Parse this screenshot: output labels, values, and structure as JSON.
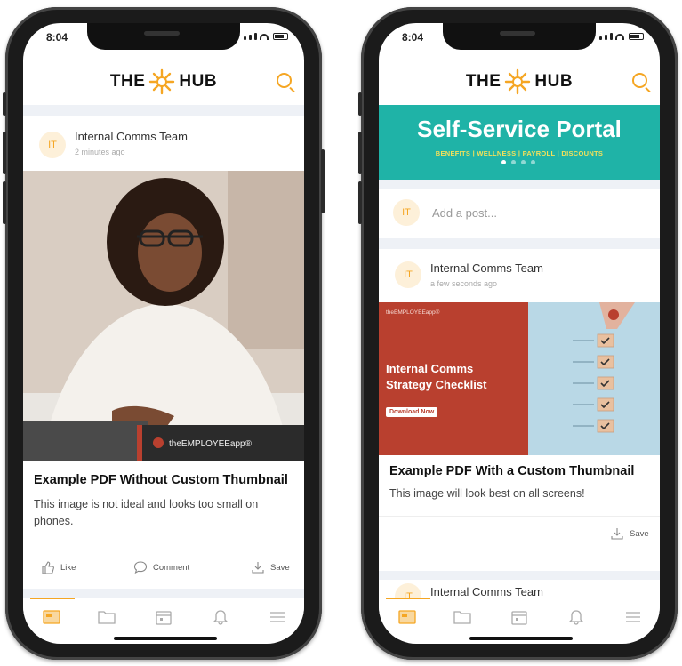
{
  "left_phone": {
    "time": "8:04",
    "app_title_left": "THE",
    "app_title_right": "HUB",
    "post": {
      "avatar": "IT",
      "author": "Internal Comms Team",
      "time_ago": "2 minutes ago",
      "image_overlay_brand": "theEMPLOYEEapp®",
      "title": "Example PDF Without Custom Thumbnail",
      "description": "This image is not ideal and looks too small on phones.",
      "actions": {
        "like": "Like",
        "comment": "Comment",
        "save": "Save"
      }
    },
    "tabs": [
      "home-icon",
      "folder-icon",
      "calendar-icon",
      "bell-icon",
      "menu-icon"
    ]
  },
  "right_phone": {
    "time": "8:04",
    "app_title_left": "THE",
    "app_title_right": "HUB",
    "banner": {
      "title": "Self-Service Portal",
      "subtitle": "BENEFITS | WELLNESS | PAYROLL | DISCOUNTS",
      "bg_color": "#1fb3a7"
    },
    "composer": {
      "avatar": "IT",
      "placeholder": "Add a post..."
    },
    "post": {
      "avatar": "IT",
      "author": "Internal Comms Team",
      "time_ago": "a few seconds ago",
      "thumb_brand": "theEMPLOYEEapp®",
      "thumb_heading": "Internal Comms Strategy Checklist",
      "thumb_button": "Download Now",
      "title": "Example PDF With a Custom Thumbnail",
      "description": "This image will look best on all screens!",
      "save": "Save"
    },
    "next_post_author": "Internal Comms Team",
    "tabs": [
      "home-icon",
      "folder-icon",
      "calendar-icon",
      "bell-icon",
      "menu-icon"
    ]
  },
  "colors": {
    "accent": "#f5a623",
    "teal": "#1fb3a7",
    "brick": "#b9402f"
  }
}
